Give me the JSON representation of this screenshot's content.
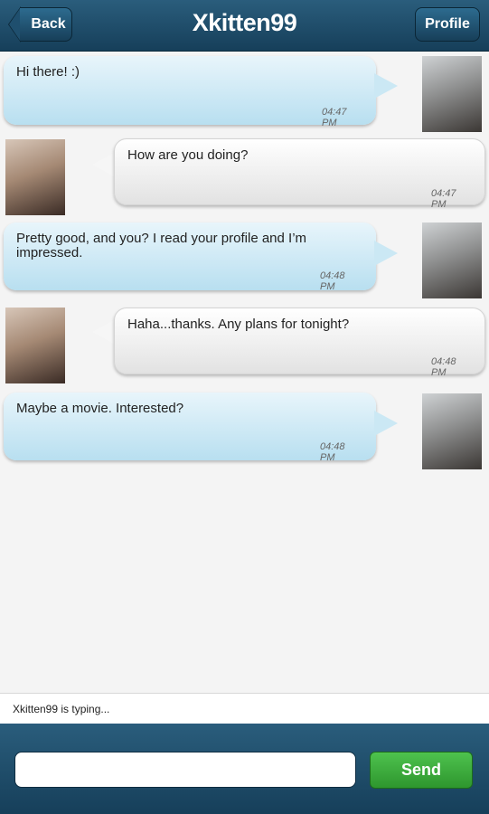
{
  "header": {
    "title": "Xkitten99",
    "back_label": "Back",
    "profile_label": "Profile"
  },
  "messages": [
    {
      "direction": "out",
      "text": "Hi there! :)",
      "time": "04:47 PM"
    },
    {
      "direction": "in",
      "text": "How are you doing?",
      "time": "04:47 PM"
    },
    {
      "direction": "out",
      "text": "Pretty good, and you? I read your profile and I’m impressed.",
      "time": "04:48 PM"
    },
    {
      "direction": "in",
      "text": "Haha...thanks. Any plans for tonight?",
      "time": "04:48 PM"
    },
    {
      "direction": "out",
      "text": "Maybe a movie. Interested?",
      "time": "04:48 PM"
    }
  ],
  "status": {
    "typing": "Xkitten99 is typing..."
  },
  "composer": {
    "input_value": "",
    "send_label": "Send"
  },
  "colors": {
    "header": "#1f4f6e",
    "outgoing_bubble": "#bfe3f2",
    "incoming_bubble": "#f0f0f0",
    "send": "#3aa83a"
  }
}
